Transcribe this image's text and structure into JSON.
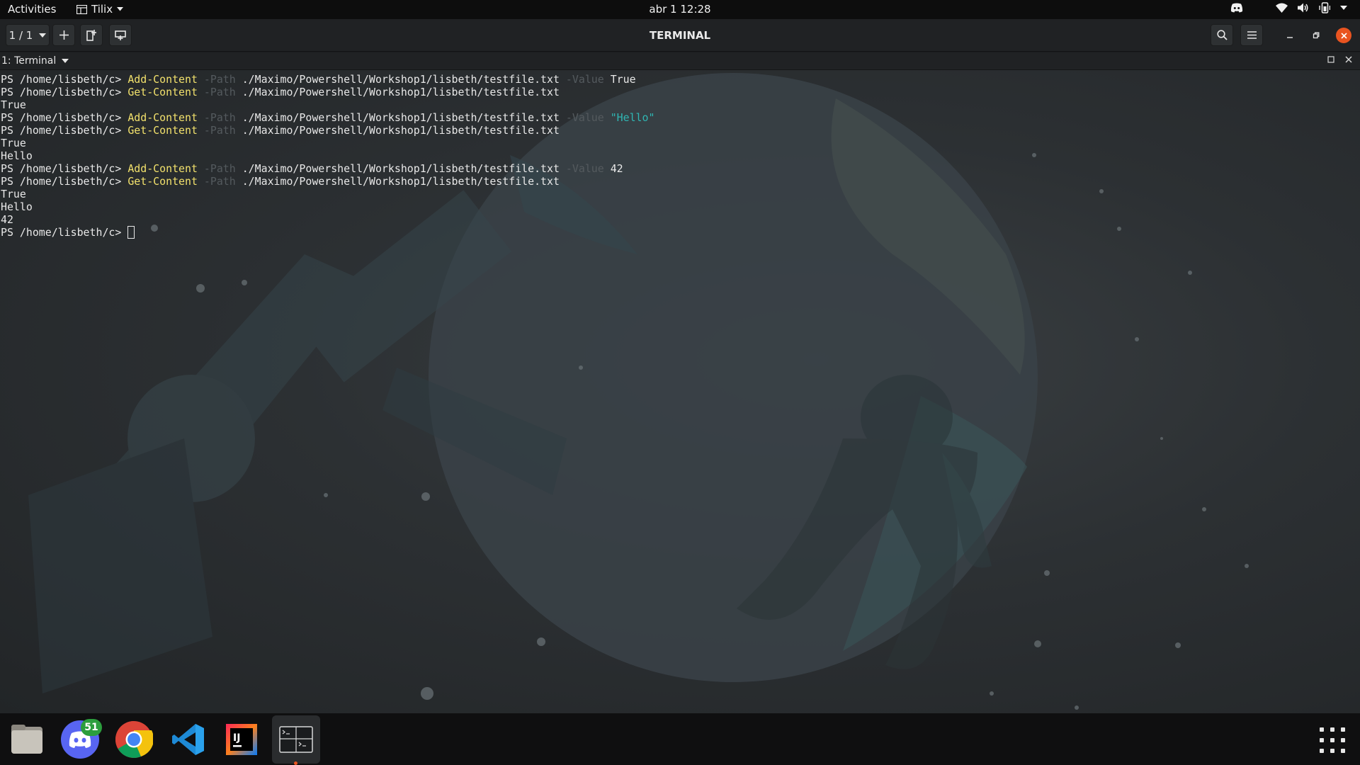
{
  "topbar": {
    "activities": "Activities",
    "app_name": "Tilix",
    "clock": "abr 1  12:28",
    "tray_icons": [
      "discord-tray-icon",
      "wifi-icon",
      "volume-icon",
      "battery-phone-icon",
      "system-menu-chevron-icon"
    ]
  },
  "window": {
    "title": "TERMINAL",
    "session_label": "1 / 1",
    "terminal_tab_label": "1: Terminal"
  },
  "terminal": {
    "prompt": "PS /home/lisbeth/c> ",
    "lines": [
      {
        "type": "cmd",
        "cmd": "Add-Content",
        "p1": "-Path",
        "path": "./Maximo/Powershell/Workshop1/lisbeth/testfile.txt",
        "p2": "-Value",
        "value": "True",
        "value_style": "plain"
      },
      {
        "type": "cmd",
        "cmd": "Get-Content",
        "p1": "-Path",
        "path": "./Maximo/Powershell/Workshop1/lisbeth/testfile.txt"
      },
      {
        "type": "out",
        "text": "True"
      },
      {
        "type": "cmd",
        "cmd": "Add-Content",
        "p1": "-Path",
        "path": "./Maximo/Powershell/Workshop1/lisbeth/testfile.txt",
        "p2": "-Value",
        "value": "\"Hello\"",
        "value_style": "string"
      },
      {
        "type": "cmd",
        "cmd": "Get-Content",
        "p1": "-Path",
        "path": "./Maximo/Powershell/Workshop1/lisbeth/testfile.txt"
      },
      {
        "type": "out",
        "text": "True"
      },
      {
        "type": "out",
        "text": "Hello"
      },
      {
        "type": "cmd",
        "cmd": "Add-Content",
        "p1": "-Path",
        "path": "./Maximo/Powershell/Workshop1/lisbeth/testfile.txt",
        "p2": "-Value",
        "value": "42",
        "value_style": "plain"
      },
      {
        "type": "cmd",
        "cmd": "Get-Content",
        "p1": "-Path",
        "path": "./Maximo/Powershell/Workshop1/lisbeth/testfile.txt"
      },
      {
        "type": "out",
        "text": "True"
      },
      {
        "type": "out",
        "text": "Hello"
      },
      {
        "type": "out",
        "text": "42"
      },
      {
        "type": "prompt"
      }
    ]
  },
  "dock": {
    "items": [
      {
        "name": "files-app",
        "icon": "folder-icon",
        "running": false
      },
      {
        "name": "discord-app",
        "icon": "discord-icon",
        "running": true,
        "badge": "51"
      },
      {
        "name": "chrome-app",
        "icon": "chrome-icon",
        "running": false
      },
      {
        "name": "vscode-app",
        "icon": "vscode-icon",
        "running": true
      },
      {
        "name": "intellij-app",
        "icon": "intellij-icon",
        "running": false,
        "text": "IJ"
      },
      {
        "name": "tilix-app",
        "icon": "terminal-icon",
        "running": true,
        "active": true
      }
    ],
    "show_apps_icon": "grid-icon"
  },
  "colors": {
    "accent": "#e95420",
    "command": "#f2e16c",
    "parameter": "#545a5e",
    "string": "#2fb6b3",
    "badge": "#2c9e3d"
  }
}
